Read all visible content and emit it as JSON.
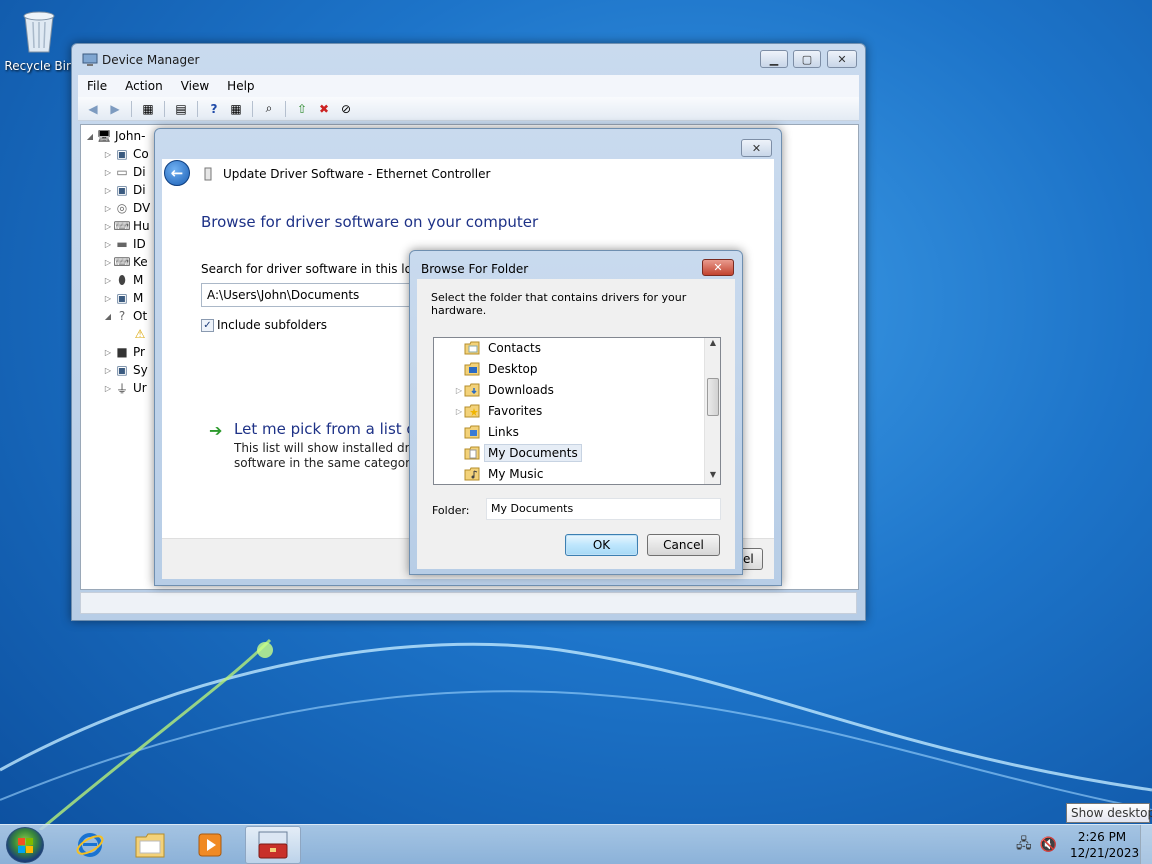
{
  "desktop": {
    "recycle_bin_label": "Recycle Bin"
  },
  "device_manager": {
    "title": "Device Manager",
    "menu": [
      "File",
      "Action",
      "View",
      "Help"
    ],
    "tree": {
      "root_label": "John-",
      "children": [
        {
          "label": "Co",
          "icon": "computer-icon"
        },
        {
          "label": "Di",
          "icon": "disk-drive-icon"
        },
        {
          "label": "Di",
          "icon": "display-adapter-icon"
        },
        {
          "label": "DV",
          "icon": "dvd-drive-icon"
        },
        {
          "label": "Hu",
          "icon": "hid-icon"
        },
        {
          "label": "ID",
          "icon": "ide-controller-icon"
        },
        {
          "label": "Ke",
          "icon": "keyboard-icon"
        },
        {
          "label": "M",
          "icon": "mouse-icon"
        },
        {
          "label": "M",
          "icon": "monitor-icon"
        },
        {
          "label": "Ot",
          "icon": "other-devices-icon"
        },
        {
          "label": "",
          "icon": "unknown-device-warning-icon"
        },
        {
          "label": "Pr",
          "icon": "processor-icon"
        },
        {
          "label": "Sy",
          "icon": "system-devices-icon"
        },
        {
          "label": "Ur",
          "icon": "usb-icon"
        }
      ]
    }
  },
  "wizard": {
    "title": "Update Driver Software - Ethernet Controller",
    "heading": "Browse for driver software on your computer",
    "search_label": "Search for driver software in this locatio",
    "path_value": "A:\\Users\\John\\Documents",
    "include_subfolders_label": "Include subfolders",
    "include_subfolders_checked": true,
    "pick_link": "Let me pick from a list of",
    "pick_desc_line1": "This list will show installed driver",
    "pick_desc_line2": "software in the same category as t",
    "cancel_partial": "el"
  },
  "browse_dialog": {
    "title": "Browse For Folder",
    "close_label": "✕",
    "instruction": "Select the folder that contains drivers for your hardware.",
    "folders": [
      {
        "label": "Contacts",
        "expandable": false,
        "selected": false
      },
      {
        "label": "Desktop",
        "expandable": false,
        "selected": false
      },
      {
        "label": "Downloads",
        "expandable": true,
        "selected": false
      },
      {
        "label": "Favorites",
        "expandable": true,
        "selected": false
      },
      {
        "label": "Links",
        "expandable": false,
        "selected": false
      },
      {
        "label": "My Documents",
        "expandable": false,
        "selected": true
      },
      {
        "label": "My Music",
        "expandable": false,
        "selected": false
      }
    ],
    "folder_label": "Folder:",
    "folder_value": "My Documents",
    "ok_label": "OK",
    "cancel_label": "Cancel"
  },
  "taskbar": {
    "clock_time": "2:26 PM",
    "clock_date": "12/21/2023",
    "show_desktop_tooltip": "Show desktop",
    "apps": [
      "internet-explorer-icon",
      "file-explorer-icon",
      "media-player-icon",
      "device-manager-toolbox-icon"
    ]
  },
  "colors": {
    "accent_heading": "#1e3287",
    "desktop_blue": "#1d74c9",
    "close_red": "#c2432f"
  }
}
